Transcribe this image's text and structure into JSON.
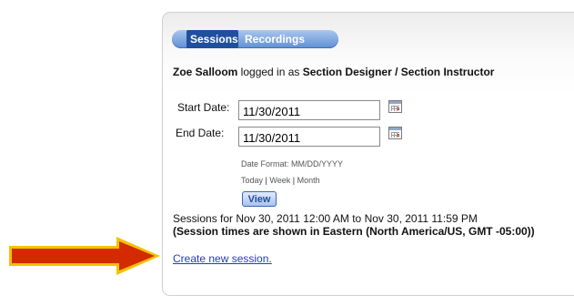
{
  "tabs": [
    {
      "label": "Sessions",
      "active": true
    },
    {
      "label": "Recordings",
      "active": false
    }
  ],
  "login": {
    "user": "Zoe Salloom",
    "middle": " logged in as ",
    "role": "Section Designer / Section Instructor"
  },
  "start_date": {
    "label": "Start Date:",
    "value": "11/30/2011"
  },
  "end_date": {
    "label": "End Date:",
    "value": "11/30/2011"
  },
  "date_format": "Date Format: MM/DD/YYYY",
  "quick_links": {
    "today": "Today",
    "sep": "|",
    "week": "Week",
    "month": "Month"
  },
  "view_button": "View",
  "sessions_range": "Sessions for Nov 30, 2011 12:00 AM to Nov 30, 2011 11:59 PM",
  "timezone_note": "(Session times are shown in Eastern (North America/US, GMT -05:00))",
  "create_link": "Create new session.",
  "icons": {
    "calendar": "calendar-icon",
    "arrow": "arrow-right-icon"
  },
  "colors": {
    "tab_active": "#1f4f9e",
    "tab_bar": "#6f9ad8",
    "link": "#1a3fc2",
    "arrow_fill": "#d42a00",
    "arrow_border": "#f2c200"
  }
}
